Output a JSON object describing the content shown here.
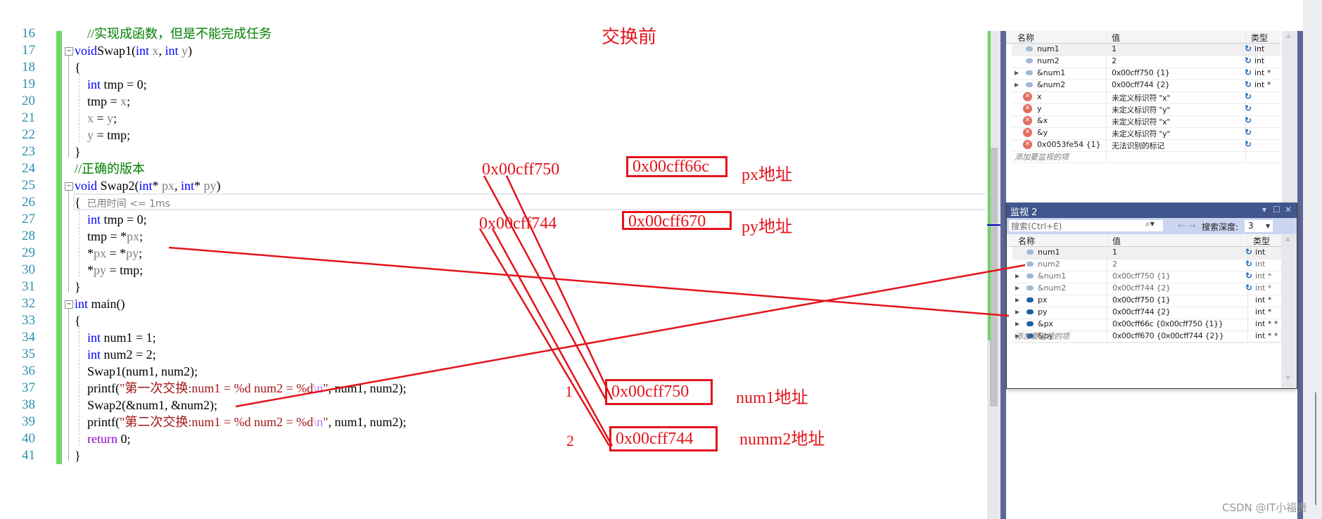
{
  "editor": {
    "lines": [
      {
        "n": "16",
        "parts": [
          [
            "cm",
            "    //实现成函数，但是不能完成任务"
          ]
        ]
      },
      {
        "n": "17",
        "fold": true,
        "parts": [
          [
            "kw",
            "void"
          ],
          [
            "",
            "Swap1("
          ],
          [
            "kw",
            "int"
          ],
          [
            "par",
            " x"
          ],
          [
            "",
            ", "
          ],
          [
            "kw",
            "int"
          ],
          [
            "par",
            " y"
          ],
          [
            "",
            ")"
          ]
        ]
      },
      {
        "n": "18",
        "parts": [
          [
            "",
            "{"
          ]
        ]
      },
      {
        "n": "19",
        "parts": [
          [
            "",
            "    "
          ],
          [
            "kw",
            "int"
          ],
          [
            "",
            " tmp = 0;"
          ]
        ]
      },
      {
        "n": "20",
        "parts": [
          [
            "",
            "    tmp = "
          ],
          [
            "par",
            "x"
          ],
          [
            "",
            ";"
          ]
        ]
      },
      {
        "n": "21",
        "parts": [
          [
            "par",
            "    x"
          ],
          [
            "",
            " = "
          ],
          [
            "par",
            "y"
          ],
          [
            "",
            ";"
          ]
        ]
      },
      {
        "n": "22",
        "parts": [
          [
            "par",
            "    y"
          ],
          [
            "",
            " = tmp;"
          ]
        ]
      },
      {
        "n": "23",
        "parts": [
          [
            "",
            "}"
          ]
        ]
      },
      {
        "n": "24",
        "parts": [
          [
            "cm",
            "//正确的版本"
          ]
        ]
      },
      {
        "n": "25",
        "fold": true,
        "parts": [
          [
            "kw",
            "void"
          ],
          [
            "",
            " Swap2("
          ],
          [
            "kw",
            "int"
          ],
          [
            "",
            "* "
          ],
          [
            "par",
            "px"
          ],
          [
            "",
            ", "
          ],
          [
            "kw",
            "int"
          ],
          [
            "",
            "* "
          ],
          [
            "par",
            "py"
          ],
          [
            "",
            ")"
          ]
        ]
      },
      {
        "n": "26",
        "parts": [
          [
            "",
            "{  "
          ],
          [
            "tip",
            "已用时间 <= 1ms"
          ]
        ]
      },
      {
        "n": "27",
        "parts": [
          [
            "",
            "    "
          ],
          [
            "kw",
            "int"
          ],
          [
            "",
            " tmp = 0;"
          ]
        ]
      },
      {
        "n": "28",
        "parts": [
          [
            "",
            "    tmp = *"
          ],
          [
            "par",
            "px"
          ],
          [
            "",
            ";"
          ]
        ]
      },
      {
        "n": "29",
        "parts": [
          [
            "",
            "    *"
          ],
          [
            "par",
            "px"
          ],
          [
            "",
            " = *"
          ],
          [
            "par",
            "py"
          ],
          [
            "",
            ";"
          ]
        ]
      },
      {
        "n": "30",
        "parts": [
          [
            "",
            "    *"
          ],
          [
            "par",
            "py"
          ],
          [
            "",
            " = tmp;"
          ]
        ]
      },
      {
        "n": "31",
        "parts": [
          [
            "",
            "}"
          ]
        ]
      },
      {
        "n": "32",
        "fold": true,
        "parts": [
          [
            "kw",
            "int"
          ],
          [
            "",
            " main()"
          ]
        ]
      },
      {
        "n": "33",
        "parts": [
          [
            "",
            "{"
          ]
        ]
      },
      {
        "n": "34",
        "parts": [
          [
            "",
            "    "
          ],
          [
            "kw",
            "int"
          ],
          [
            "",
            " num1 = 1;"
          ]
        ]
      },
      {
        "n": "35",
        "parts": [
          [
            "",
            "    "
          ],
          [
            "kw",
            "int"
          ],
          [
            "",
            " num2 = 2;"
          ]
        ]
      },
      {
        "n": "36",
        "parts": [
          [
            "",
            "    Swap1(num1, num2);"
          ]
        ]
      },
      {
        "n": "37",
        "parts": [
          [
            "",
            "    printf("
          ],
          [
            "str",
            "\"第一次交换:num1 = %d num2 = %d"
          ],
          [
            "esc",
            "\\n"
          ],
          [
            "str",
            "\""
          ],
          [
            "",
            ", num1, num2);"
          ]
        ]
      },
      {
        "n": "38",
        "parts": [
          [
            "",
            "    Swap2(&num1, &num2);"
          ]
        ]
      },
      {
        "n": "39",
        "parts": [
          [
            "",
            "    printf("
          ],
          [
            "str",
            "\"第二次交换:num1 = %d num2 = %d"
          ],
          [
            "esc",
            "\\n"
          ],
          [
            "str",
            "\""
          ],
          [
            "",
            ", num1, num2);"
          ]
        ]
      },
      {
        "n": "40",
        "parts": [
          [
            "",
            "    "
          ],
          [
            "ret",
            "return"
          ],
          [
            "",
            " 0;"
          ]
        ]
      },
      {
        "n": "41",
        "parts": [
          [
            "",
            "}"
          ]
        ]
      }
    ]
  },
  "annotations": {
    "title": "交换前",
    "num1_addr_plain": "0x00cff750",
    "num2_addr_plain": "0x00cff744",
    "px_addr_boxed": "0x00cff66c",
    "px_label": "px地址",
    "py_addr_boxed": "0x00cff670",
    "py_label": "py地址",
    "num1_box": "0x00cff750",
    "num1_label": "num1地址",
    "num1_index": "1",
    "num2_box": "0x00cff744",
    "num2_label": "numm2地址",
    "num2_index": "2",
    "color": "#e3141c"
  },
  "watch1": {
    "columns": [
      "名称",
      "值",
      "类型"
    ],
    "rows": [
      {
        "expand": "",
        "icon": "variable-icon",
        "name": "num1",
        "value": "1",
        "refresh": true,
        "type": "int",
        "selected": true
      },
      {
        "expand": "",
        "icon": "variable-icon",
        "name": "num2",
        "value": "2",
        "refresh": true,
        "type": "int"
      },
      {
        "expand": "▶",
        "icon": "variable-icon",
        "name": "&num1",
        "value": "0x00cff750 {1}",
        "refresh": true,
        "type": "int *"
      },
      {
        "expand": "▶",
        "icon": "variable-icon",
        "name": "&num2",
        "value": "0x00cff744 {2}",
        "refresh": true,
        "type": "int *"
      },
      {
        "expand": "",
        "icon": "error-icon",
        "name": "x",
        "value": "未定义标识符 \"x\"",
        "refresh": true,
        "type": ""
      },
      {
        "expand": "",
        "icon": "error-icon",
        "name": "y",
        "value": "未定义标识符 \"y\"",
        "refresh": true,
        "type": ""
      },
      {
        "expand": "",
        "icon": "error-icon",
        "name": "&x",
        "value": "未定义标识符 \"x\"",
        "refresh": true,
        "type": ""
      },
      {
        "expand": "",
        "icon": "error-icon",
        "name": "&y",
        "value": "未定义标识符 \"y\"",
        "refresh": true,
        "type": ""
      },
      {
        "expand": "",
        "icon": "error-icon",
        "name": "0x0053fe54 {1}",
        "value": "无法识别的标记",
        "refresh": true,
        "type": ""
      }
    ],
    "add_placeholder": "添加要监视的项"
  },
  "watch2": {
    "title": "监视 2",
    "search_placeholder": "搜索(Ctrl+E)",
    "search_depth_label": "搜索深度:",
    "search_depth_value": "3",
    "columns": [
      "名称",
      "值",
      "类型"
    ],
    "rows": [
      {
        "expand": "",
        "icon": "variable-icon",
        "name": "num1",
        "value": "1",
        "refresh": true,
        "type": "int",
        "selected": true
      },
      {
        "expand": "",
        "icon": "variable-icon",
        "name": "num2",
        "value": "2",
        "refresh": true,
        "type": "int",
        "dim": true
      },
      {
        "expand": "▶",
        "icon": "variable-icon",
        "name": "&num1",
        "value": "0x00cff750 {1}",
        "refresh": true,
        "type": "int *",
        "dim": true
      },
      {
        "expand": "▶",
        "icon": "variable-icon",
        "name": "&num2",
        "value": "0x00cff744 {2}",
        "refresh": true,
        "type": "int *",
        "dim": true
      },
      {
        "expand": "▶",
        "icon": "variable-dark-icon",
        "name": "px",
        "value": "0x00cff750 {1}",
        "refresh": false,
        "type": "int *"
      },
      {
        "expand": "▶",
        "icon": "variable-dark-icon",
        "name": "py",
        "value": "0x00cff744 {2}",
        "refresh": false,
        "type": "int *"
      },
      {
        "expand": "▶",
        "icon": "variable-dark-icon",
        "name": "&px",
        "value": "0x00cff66c {0x00cff750 {1}}",
        "refresh": false,
        "type": "int * *"
      },
      {
        "expand": "▶",
        "icon": "variable-dark-icon",
        "name": "&py",
        "value": "0x00cff670 {0x00cff744 {2}}",
        "refresh": false,
        "type": "int * *"
      }
    ],
    "add_placeholder": "添加要监视的项"
  },
  "watermark": "CSDN @IT小福贵"
}
